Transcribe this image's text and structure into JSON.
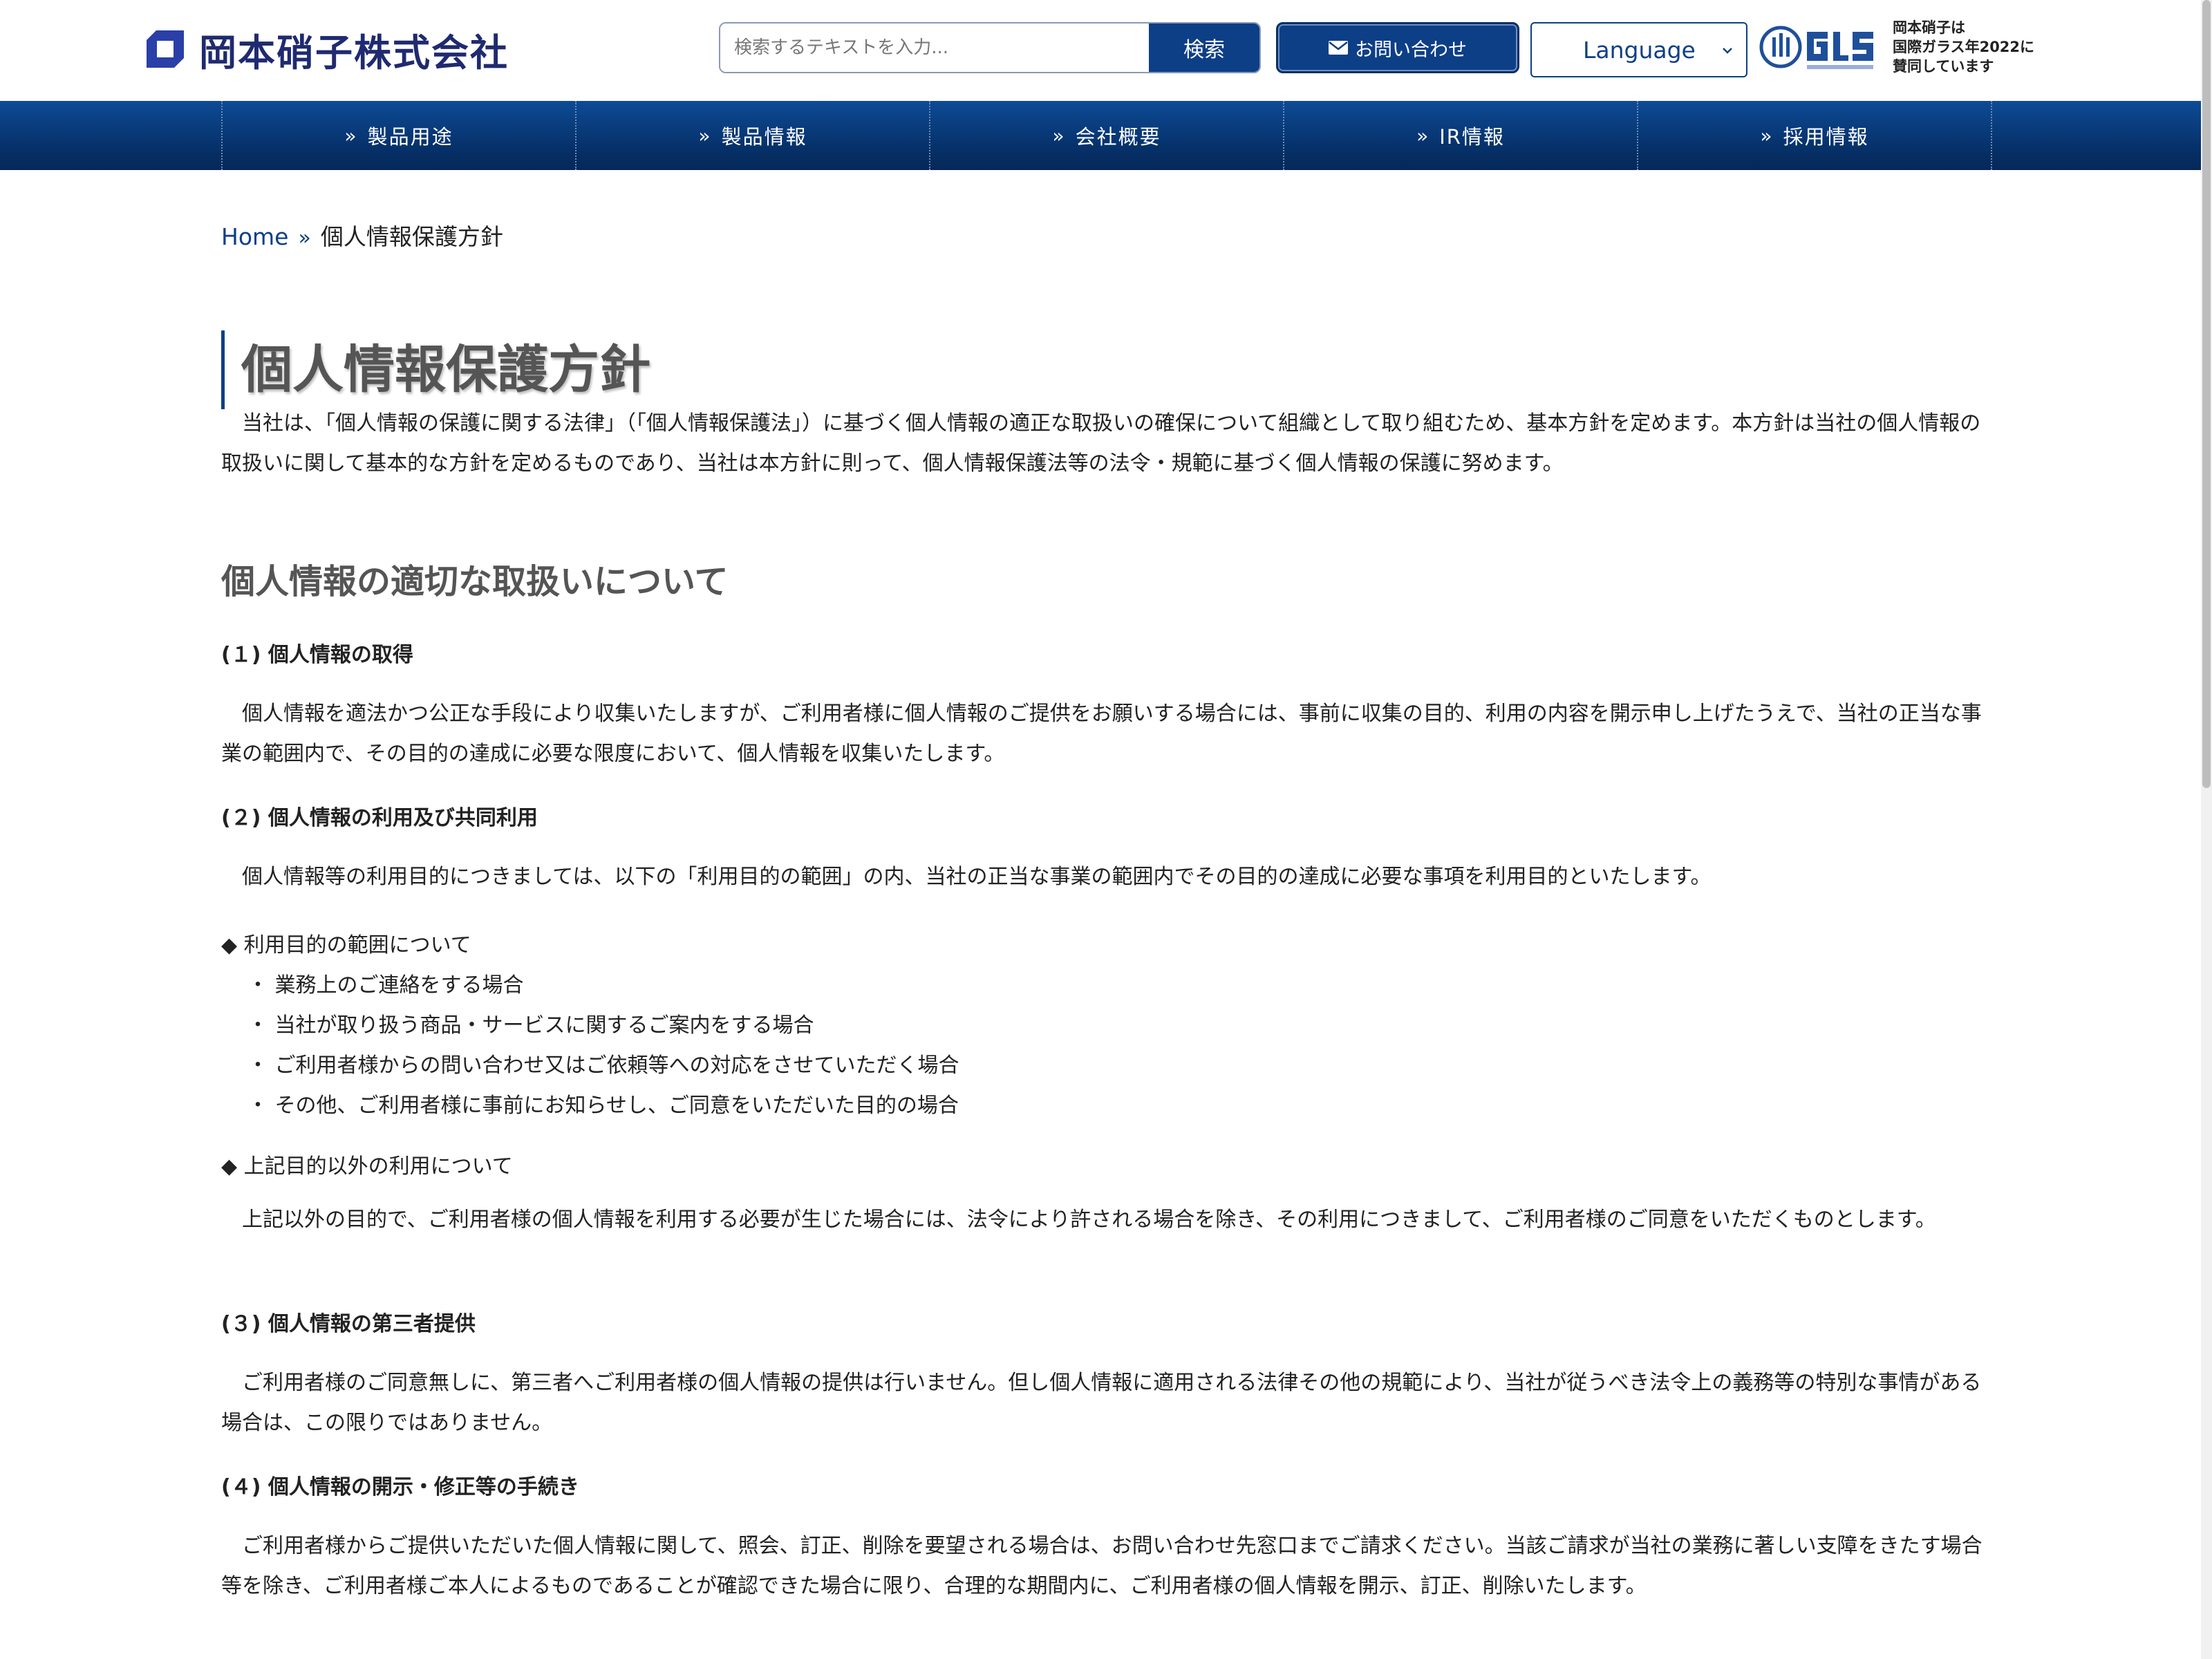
{
  "header": {
    "company_name": "岡本硝子株式会社",
    "search": {
      "placeholder": "検索するテキストを入力...",
      "button": "検索"
    },
    "contact_button": "お問い合わせ",
    "language_select": "Language",
    "glass_badge": {
      "line1": "岡本硝子は",
      "line2": "国際ガラス年2022に",
      "line3": "賛同しています"
    }
  },
  "nav": {
    "items": [
      {
        "label": "製品用途"
      },
      {
        "label": "製品情報"
      },
      {
        "label": "会社概要"
      },
      {
        "label": "IR情報"
      },
      {
        "label": "採用情報"
      }
    ]
  },
  "breadcrumb": {
    "home": "Home",
    "current": "個人情報保護方針"
  },
  "page": {
    "title": "個人情報保護方針",
    "intro": "　当社は、「個人情報の保護に関する法律」（「個人情報保護法」）に基づく個人情報の適正な取扱いの確保について組織として取り組むため、基本方針を定めます。本方針は当社の個人情報の取扱いに関して基本的な方針を定めるものであり、当社は本方針に則って、個人情報保護法等の法令・規範に基づく個人情報の保護に努めます。",
    "section_title": "個人情報の適切な取扱いについて",
    "s1_title": "(１) 個人情報の取得",
    "s1_text": "　個人情報を適法かつ公正な手段により収集いたしますが、ご利用者様に個人情報のご提供をお願いする場合には、事前に収集の目的、利用の内容を開示申し上げたうえで、当社の正当な事業の範囲内で、その目的の達成に必要な限度において、個人情報を収集いたします。",
    "s2_title": "(２) 個人情報の利用及び共同利用",
    "s2_text": "　個人情報等の利用目的につきましては、以下の「利用目的の範囲」の内、当社の正当な事業の範囲内でその目的の達成に必要な事項を利用目的といたします。",
    "purpose_heading": "◆ 利用目的の範囲について",
    "purpose_items": [
      "・ 業務上のご連絡をする場合",
      "・ 当社が取り扱う商品・サービスに関するご案内をする場合",
      "・ ご利用者様からの問い合わせ又はご依頼等への対応をさせていただく場合",
      "・ その他、ご利用者様に事前にお知らせし、ご同意をいただいた目的の場合"
    ],
    "other_heading": "◆ 上記目的以外の利用について",
    "other_text": "　上記以外の目的で、ご利用者様の個人情報を利用する必要が生じた場合には、法令により許される場合を除き、その利用につきまして、ご利用者様のご同意をいただくものとします。",
    "s3_title": "(３) 個人情報の第三者提供",
    "s3_text": "　ご利用者様のご同意無しに、第三者へご利用者様の個人情報の提供は行いません。但し個人情報に適用される法律その他の規範により、当社が従うべき法令上の義務等の特別な事情がある場合は、この限りではありません。",
    "s4_title": "(４) 個人情報の開示・修正等の手続き",
    "s4_text": "　ご利用者様からご提供いただいた個人情報に関して、照会、訂正、削除を要望される場合は、お問い合わせ先窓口までご請求ください。当該ご請求が当社の業務に著しい支障をきたす場合等を除き、ご利用者様ご本人によるものであることが確認できた場合に限り、合理的な期間内に、ご利用者様の個人情報を開示、訂正、削除いたします。"
  },
  "colors": {
    "brand": "#0d3f86",
    "nav_dark": "#052858",
    "heading_gray": "#555555"
  }
}
